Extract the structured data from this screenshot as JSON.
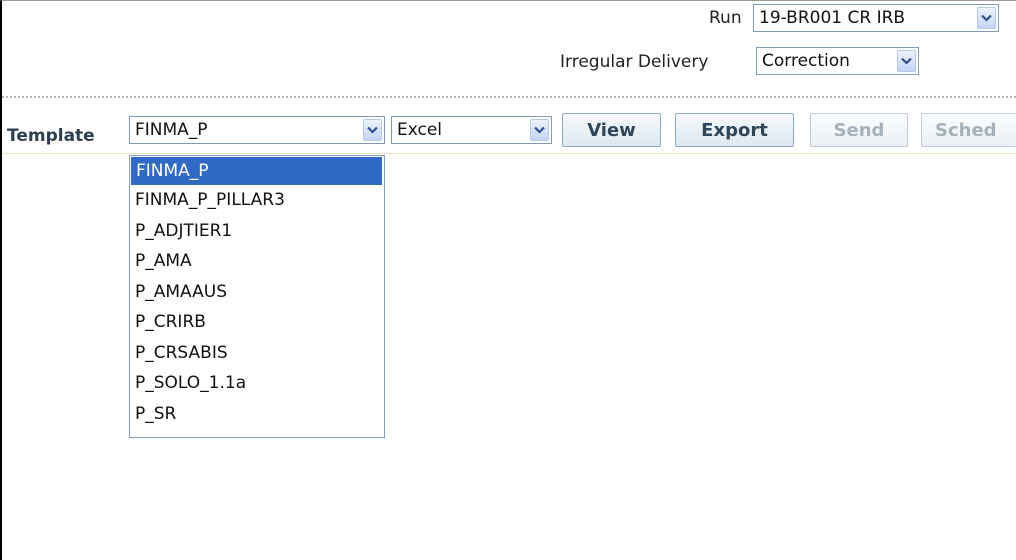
{
  "run": {
    "label": "Run",
    "value": "19-BR001 CR IRB"
  },
  "irregular_delivery": {
    "label": "Irregular Delivery",
    "value": "Correction"
  },
  "template": {
    "label": "Template",
    "value": "FINMA_P",
    "options": [
      "FINMA_P",
      "FINMA_P_PILLAR3",
      "P_ADJTIER1",
      "P_AMA",
      "P_AMAAUS",
      "P_CRIRB",
      "P_CRSABIS",
      "P_SOLO_1.1a",
      "P_SR"
    ]
  },
  "format": {
    "value": "Excel"
  },
  "buttons": {
    "view": "View",
    "export": "Export",
    "send": "Send",
    "schedule": "Sched"
  },
  "colors": {
    "selection": "#316ac5",
    "select_border": "#7f9db9"
  }
}
